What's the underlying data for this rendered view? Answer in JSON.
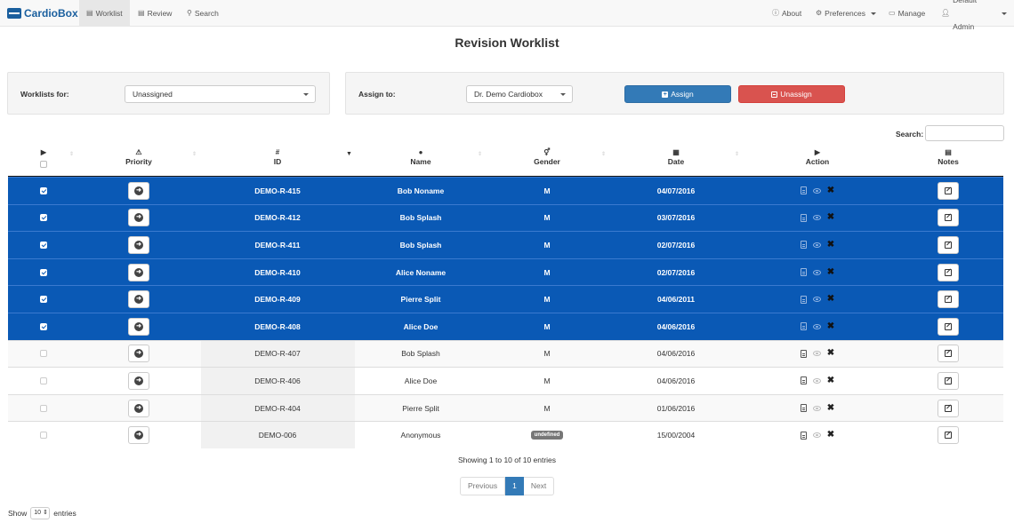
{
  "navbar": {
    "brand": "CardioBox",
    "links": [
      {
        "label": "Worklist",
        "icon": "document-icon"
      },
      {
        "label": "Review",
        "icon": "document-icon"
      },
      {
        "label": "Search",
        "icon": "search-icon"
      }
    ],
    "right": [
      {
        "label": "About",
        "icon": "info-icon"
      },
      {
        "label": "Preferences",
        "icon": "gears-icon"
      },
      {
        "label": "Manage",
        "icon": "list-icon"
      },
      {
        "label": "Default Admin",
        "icon": "user-icon"
      }
    ]
  },
  "page_title": "Revision Worklist",
  "filter": {
    "worklists_for_label": "Worklists for:",
    "worklists_for_value": "Unassigned",
    "assign_to_label": "Assign to:",
    "assign_to_value": "Dr. Demo Cardiobox",
    "assign_button": "Assign",
    "unassign_button": "Unassign"
  },
  "search_label": "Search:",
  "table": {
    "headers": {
      "priority": "Priority",
      "id": "ID",
      "id_icon": "#",
      "name": "Name",
      "gender": "Gender",
      "date": "Date",
      "action": "Action",
      "notes": "Notes"
    },
    "rows": [
      {
        "id": "DEMO-R-415",
        "name": "Bob Noname",
        "gender": "M",
        "date": "04/07/2016",
        "selected": true
      },
      {
        "id": "DEMO-R-412",
        "name": "Bob Splash",
        "gender": "M",
        "date": "03/07/2016",
        "selected": true
      },
      {
        "id": "DEMO-R-411",
        "name": "Bob Splash",
        "gender": "M",
        "date": "02/07/2016",
        "selected": true
      },
      {
        "id": "DEMO-R-410",
        "name": "Alice Noname",
        "gender": "M",
        "date": "02/07/2016",
        "selected": true
      },
      {
        "id": "DEMO-R-409",
        "name": "Pierre Split",
        "gender": "M",
        "date": "04/06/2011",
        "selected": true
      },
      {
        "id": "DEMO-R-408",
        "name": "Alice Doe",
        "gender": "M",
        "date": "04/06/2016",
        "selected": true
      },
      {
        "id": "DEMO-R-407",
        "name": "Bob Splash",
        "gender": "M",
        "date": "04/06/2016",
        "selected": false
      },
      {
        "id": "DEMO-R-406",
        "name": "Alice Doe",
        "gender": "M",
        "date": "04/06/2016",
        "selected": false
      },
      {
        "id": "DEMO-R-404",
        "name": "Pierre Split",
        "gender": "M",
        "date": "01/06/2016",
        "selected": false
      },
      {
        "id": "DEMO-006",
        "name": "Anonymous",
        "gender": "undefined",
        "date": "15/00/2004",
        "selected": false
      }
    ]
  },
  "info": "Showing 1 to 10 of 10 entries",
  "pagination": {
    "previous": "Previous",
    "current": "1",
    "next": "Next"
  },
  "length": {
    "show": "Show",
    "value": "10",
    "entries": "entries"
  },
  "colors": {
    "selected_row": "#0a59b5",
    "assign": "#337ab7",
    "unassign": "#d9534f",
    "brand": "#1a5f9e"
  }
}
